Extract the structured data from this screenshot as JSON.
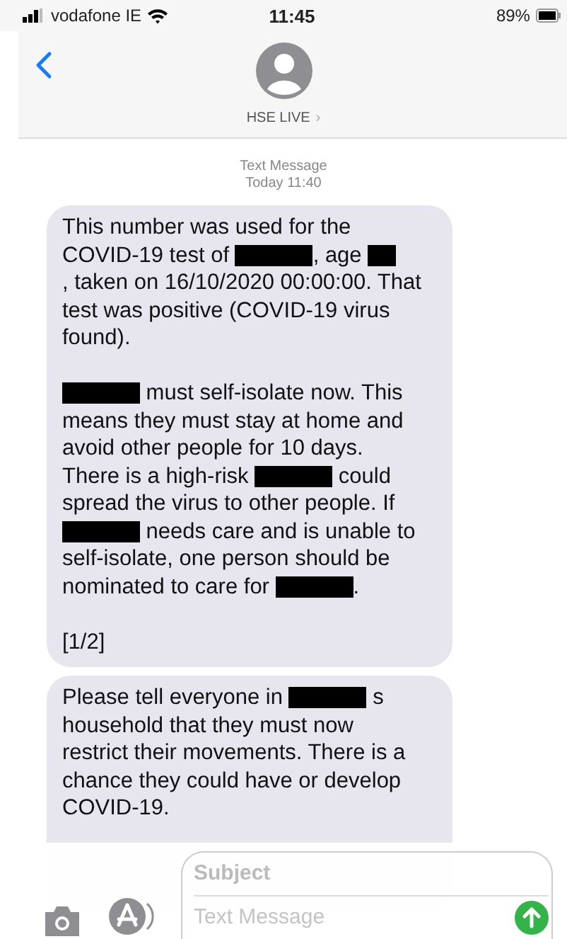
{
  "status_bar": {
    "carrier": "vodafone IE",
    "time": "11:45",
    "battery": "89%"
  },
  "header": {
    "contact": "HSE LIVE",
    "chevron": "›"
  },
  "timestamp": {
    "kind_label": "Text Message",
    "time": "Today 11:40"
  },
  "messages": [
    {
      "paragraphs": [
        [
          [
            {
              "kind": "text",
              "text": "This number was used for the"
            }
          ],
          [
            {
              "kind": "text",
              "text": "COVID-19 test of "
            },
            {
              "kind": "redaction"
            },
            {
              "kind": "text",
              "text": ", age "
            },
            {
              "kind": "short_redaction"
            }
          ],
          [
            {
              "kind": "text",
              "text": ", taken on 16/10/2020 00:00:00. That"
            }
          ],
          [
            {
              "kind": "text",
              "text": "test was positive (COVID-19 virus"
            }
          ],
          [
            {
              "kind": "text",
              "text": "found)."
            }
          ]
        ],
        [
          [
            {
              "kind": "redaction"
            },
            {
              "kind": "text",
              "text": " must self-isolate now. This"
            }
          ],
          [
            {
              "kind": "text",
              "text": "means they must stay at home and"
            }
          ],
          [
            {
              "kind": "text",
              "text": "avoid other people for 10 days."
            }
          ],
          [
            {
              "kind": "text",
              "text": "There is a high-risk "
            },
            {
              "kind": "redaction"
            },
            {
              "kind": "text",
              "text": " could"
            }
          ],
          [
            {
              "kind": "text",
              "text": "spread the virus to other people. If"
            }
          ],
          [
            {
              "kind": "redaction"
            },
            {
              "kind": "text",
              "text": " needs care and is unable to"
            }
          ],
          [
            {
              "kind": "text",
              "text": "self-isolate, one person should be"
            }
          ],
          [
            {
              "kind": "text",
              "text": "nominated to care for "
            },
            {
              "kind": "redaction"
            },
            {
              "kind": "text",
              "text": "."
            }
          ]
        ],
        [
          [
            {
              "kind": "text",
              "text": "[1/2]"
            }
          ]
        ]
      ]
    },
    {
      "paragraphs": [
        [
          [
            {
              "kind": "text",
              "text": "Please tell everyone in "
            },
            {
              "kind": "redaction"
            },
            {
              "kind": "text",
              "text": " s"
            }
          ],
          [
            {
              "kind": "text",
              "text": "household that they must now"
            }
          ],
          [
            {
              "kind": "text",
              "text": "restrict their movements. There is a"
            }
          ],
          [
            {
              "kind": "text",
              "text": "chance they could have or develop"
            }
          ],
          [
            {
              "kind": "text",
              "text": "COVID-19."
            }
          ]
        ]
      ]
    }
  ],
  "composer": {
    "subject_placeholder": "Subject",
    "message_placeholder": "Text Message"
  }
}
